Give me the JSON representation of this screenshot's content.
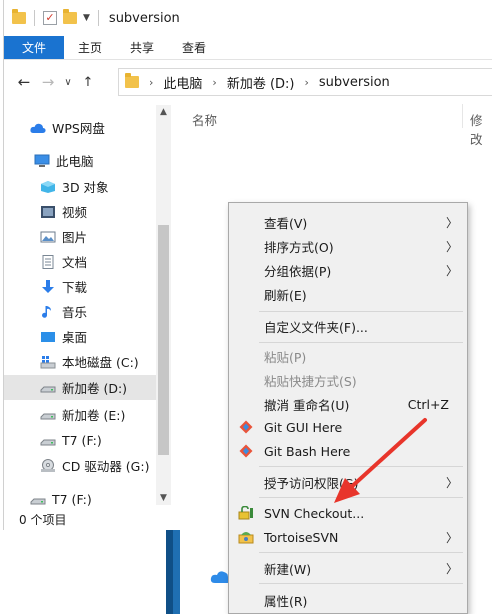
{
  "window": {
    "title": "subversion",
    "ribbon_tabs": [
      {
        "label": "文件"
      },
      {
        "label": "主页"
      },
      {
        "label": "共享"
      },
      {
        "label": "查看"
      }
    ],
    "breadcrumb": [
      "此电脑",
      "新加卷 (D:)",
      "subversion"
    ]
  },
  "nav_pane": {
    "items": [
      {
        "label": "WPS网盘",
        "icon": "wps-cloud-icon"
      },
      {
        "label": "此电脑",
        "icon": "computer-icon"
      },
      {
        "label": "3D 对象",
        "icon": "3d-objects-icon"
      },
      {
        "label": "视频",
        "icon": "video-icon"
      },
      {
        "label": "图片",
        "icon": "pictures-icon"
      },
      {
        "label": "文档",
        "icon": "documents-icon"
      },
      {
        "label": "下载",
        "icon": "download-icon"
      },
      {
        "label": "音乐",
        "icon": "music-icon"
      },
      {
        "label": "桌面",
        "icon": "desktop-icon"
      },
      {
        "label": "本地磁盘 (C:)",
        "icon": "windows-drive-icon"
      },
      {
        "label": "新加卷 (D:)",
        "icon": "drive-icon",
        "selected": true
      },
      {
        "label": "新加卷 (E:)",
        "icon": "drive-icon"
      },
      {
        "label": "T7 (F:)",
        "icon": "drive-icon"
      },
      {
        "label": "CD 驱动器 (G:)",
        "icon": "cd-drive-icon"
      },
      {
        "label": "T7 (F:)",
        "icon": "drive-icon"
      }
    ]
  },
  "content": {
    "columns": [
      "名称",
      "修改"
    ]
  },
  "status": {
    "text": "0 个项目"
  },
  "context_menu": {
    "items": [
      {
        "label": "查看(V)",
        "submenu": true
      },
      {
        "label": "排序方式(O)",
        "submenu": true
      },
      {
        "label": "分组依据(P)",
        "submenu": true
      },
      {
        "label": "刷新(E)"
      },
      {
        "label": "自定义文件夹(F)..."
      },
      {
        "label": "粘贴(P)",
        "disabled": true
      },
      {
        "label": "粘贴快捷方式(S)",
        "disabled": true
      },
      {
        "label": "撤消 重命名(U)",
        "shortcut": "Ctrl+Z"
      },
      {
        "label": "Git GUI Here",
        "icon": "git-icon"
      },
      {
        "label": "Git Bash Here",
        "icon": "git-icon"
      },
      {
        "label": "授予访问权限(G)",
        "submenu": true
      },
      {
        "label": "SVN Checkout...",
        "icon": "svn-checkout-icon"
      },
      {
        "label": "TortoiseSVN",
        "icon": "tortoisesvn-icon",
        "submenu": true
      },
      {
        "label": "新建(W)",
        "submenu": true
      },
      {
        "label": "属性(R)"
      }
    ]
  },
  "colors": {
    "file_tab": "#1a73d0",
    "annotation_arrow": "#e8352b",
    "menu_bg": "#f0f0f0"
  }
}
